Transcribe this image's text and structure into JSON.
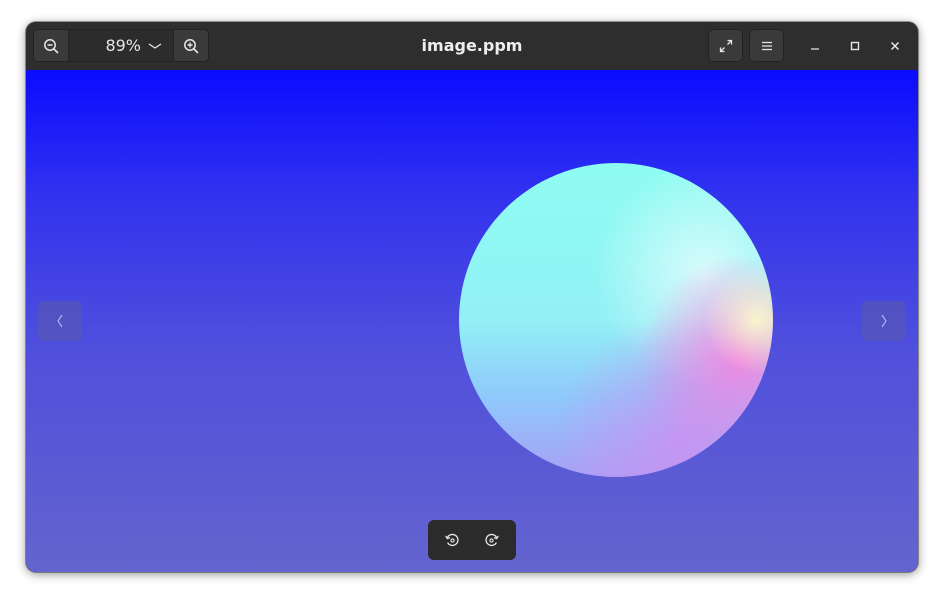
{
  "window": {
    "title": "image.ppm"
  },
  "toolbar": {
    "zoom_value": "89%",
    "zoom_out_icon": "zoom-out-icon",
    "zoom_in_icon": "zoom-in-icon",
    "zoom_dropdown_icon": "chevron-down-icon",
    "fullscreen_icon": "fullscreen-icon",
    "menu_icon": "hamburger-menu-icon"
  },
  "window_controls": {
    "minimize_icon": "minimize-icon",
    "maximize_icon": "maximize-icon",
    "close_icon": "close-icon"
  },
  "navigation": {
    "previous_icon": "chevron-left-icon",
    "next_icon": "chevron-right-icon"
  },
  "rotate": {
    "rotate_left_icon": "rotate-left-icon",
    "rotate_right_icon": "rotate-right-icon"
  },
  "image": {
    "background_top": "#0a0cff",
    "background_bottom": "#6464ce",
    "sphere_color": "#8ffcf2"
  }
}
